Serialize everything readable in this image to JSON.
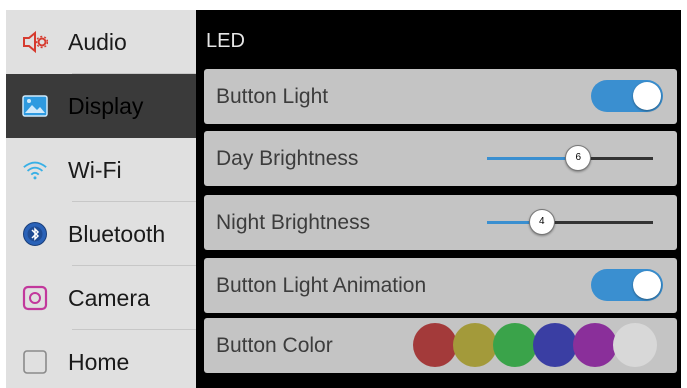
{
  "sidebar": {
    "items": [
      {
        "label": "Audio",
        "icon": "speaker-gear-icon",
        "color": "#d63b2f"
      },
      {
        "label": "Display",
        "icon": "image-icon",
        "color": "#2e9ae0"
      },
      {
        "label": "Wi-Fi",
        "icon": "wifi-icon",
        "color": "#38b0e6"
      },
      {
        "label": "Bluetooth",
        "icon": "bluetooth-icon",
        "color": "#2a62b8"
      },
      {
        "label": "Camera",
        "icon": "camera-icon",
        "color": "#c2389c"
      },
      {
        "label": "Home",
        "icon": "square-icon",
        "color": "#8a8a8a"
      }
    ],
    "active_index": 1
  },
  "main": {
    "section_title": "LED",
    "button_light": {
      "label": "Button Light",
      "on": true
    },
    "day_brightness": {
      "label": "Day Brightness",
      "value": "6",
      "fraction": 0.55
    },
    "night_brightness": {
      "label": "Night Brightness",
      "value": "4",
      "fraction": 0.33
    },
    "button_light_animation": {
      "label": "Button Light Animation",
      "on": true
    },
    "button_color": {
      "label": "Button Color",
      "swatches": [
        "#a33a3a",
        "#a39a3a",
        "#3aa34a",
        "#3a3ea3",
        "#8a2f9a",
        "#d8d8d8"
      ]
    }
  },
  "colors": {
    "accent": "#3a8fd0",
    "row_bg": "#c4c4c4",
    "sidebar_bg": "#e0e0e0"
  }
}
